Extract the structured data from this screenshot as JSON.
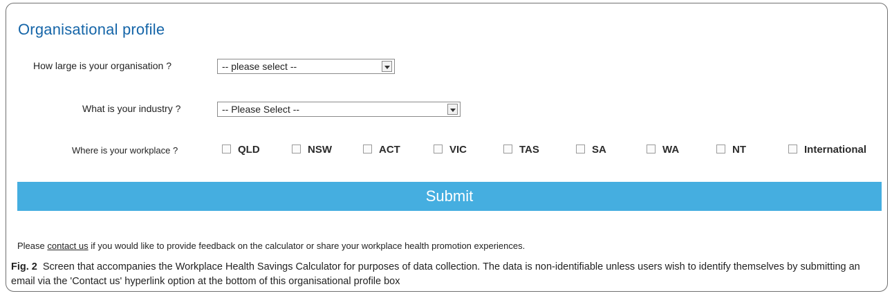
{
  "form": {
    "title": "Organisational profile",
    "size": {
      "label": "How large is your organisation ?",
      "value": "-- please select --"
    },
    "industry": {
      "label": "What is your industry ?",
      "value": "-- Please Select --"
    },
    "workplace": {
      "label": "Where is your workplace ?",
      "options": [
        "QLD",
        "NSW",
        "ACT",
        "VIC",
        "TAS",
        "SA",
        "WA",
        "NT",
        "International"
      ]
    },
    "submit_label": "Submit",
    "feedback": {
      "prefix": "Please",
      "link": "contact us",
      "suffix": "if you would like to provide feedback on the calculator or share your workplace health promotion experiences."
    }
  },
  "caption": {
    "label": "Fig. 2",
    "text": "Screen that accompanies the Workplace Health Savings Calculator for purposes of data collection. The data is non-identifiable unless users wish to identify themselves by submitting an email via the 'Contact us' hyperlink option at the bottom of this organisational profile box"
  },
  "colors": {
    "title": "#1565a8",
    "submit_bg": "#45aee0",
    "submit_text": "#ffffff"
  }
}
